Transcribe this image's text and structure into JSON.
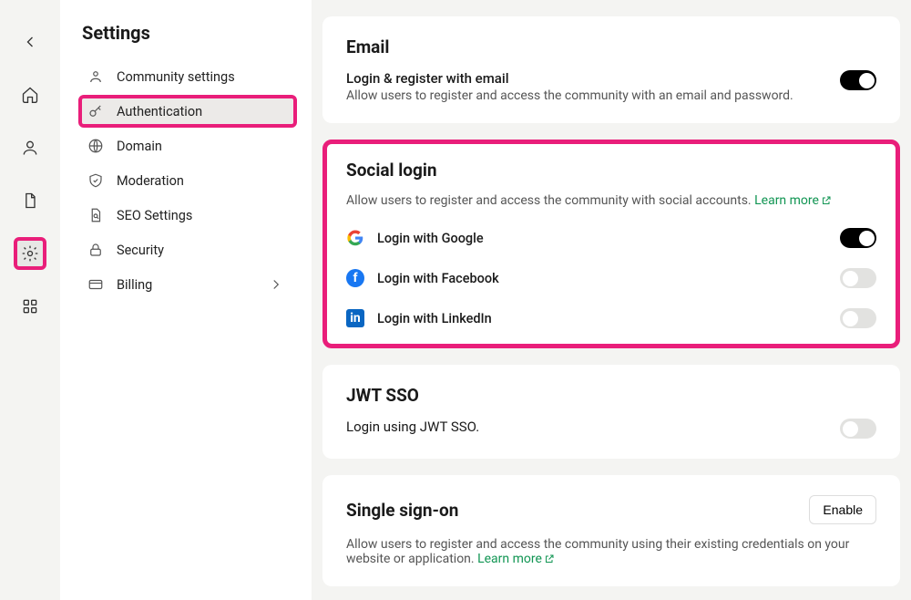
{
  "sidebar": {
    "title": "Settings",
    "items": [
      {
        "label": "Community settings"
      },
      {
        "label": "Authentication",
        "active": true
      },
      {
        "label": "Domain"
      },
      {
        "label": "Moderation"
      },
      {
        "label": "SEO Settings"
      },
      {
        "label": "Security"
      },
      {
        "label": "Billing",
        "expandable": true
      }
    ]
  },
  "email": {
    "heading": "Email",
    "title": "Login & register with email",
    "desc": "Allow users to register and access the community with an email and password."
  },
  "social": {
    "heading": "Social login",
    "desc": "Allow users to register and access the community with social accounts. ",
    "learn": "Learn more",
    "providers": [
      {
        "label": "Login with Google",
        "on": true
      },
      {
        "label": "Login with Facebook",
        "on": false
      },
      {
        "label": "Login with LinkedIn",
        "on": false
      }
    ]
  },
  "jwt": {
    "heading": "JWT SSO",
    "desc": "Login using JWT SSO."
  },
  "sso": {
    "heading": "Single sign-on",
    "enable": "Enable",
    "desc": "Allow users to register and access the community using their existing credentials on your website or application. ",
    "learn": "Learn more"
  }
}
